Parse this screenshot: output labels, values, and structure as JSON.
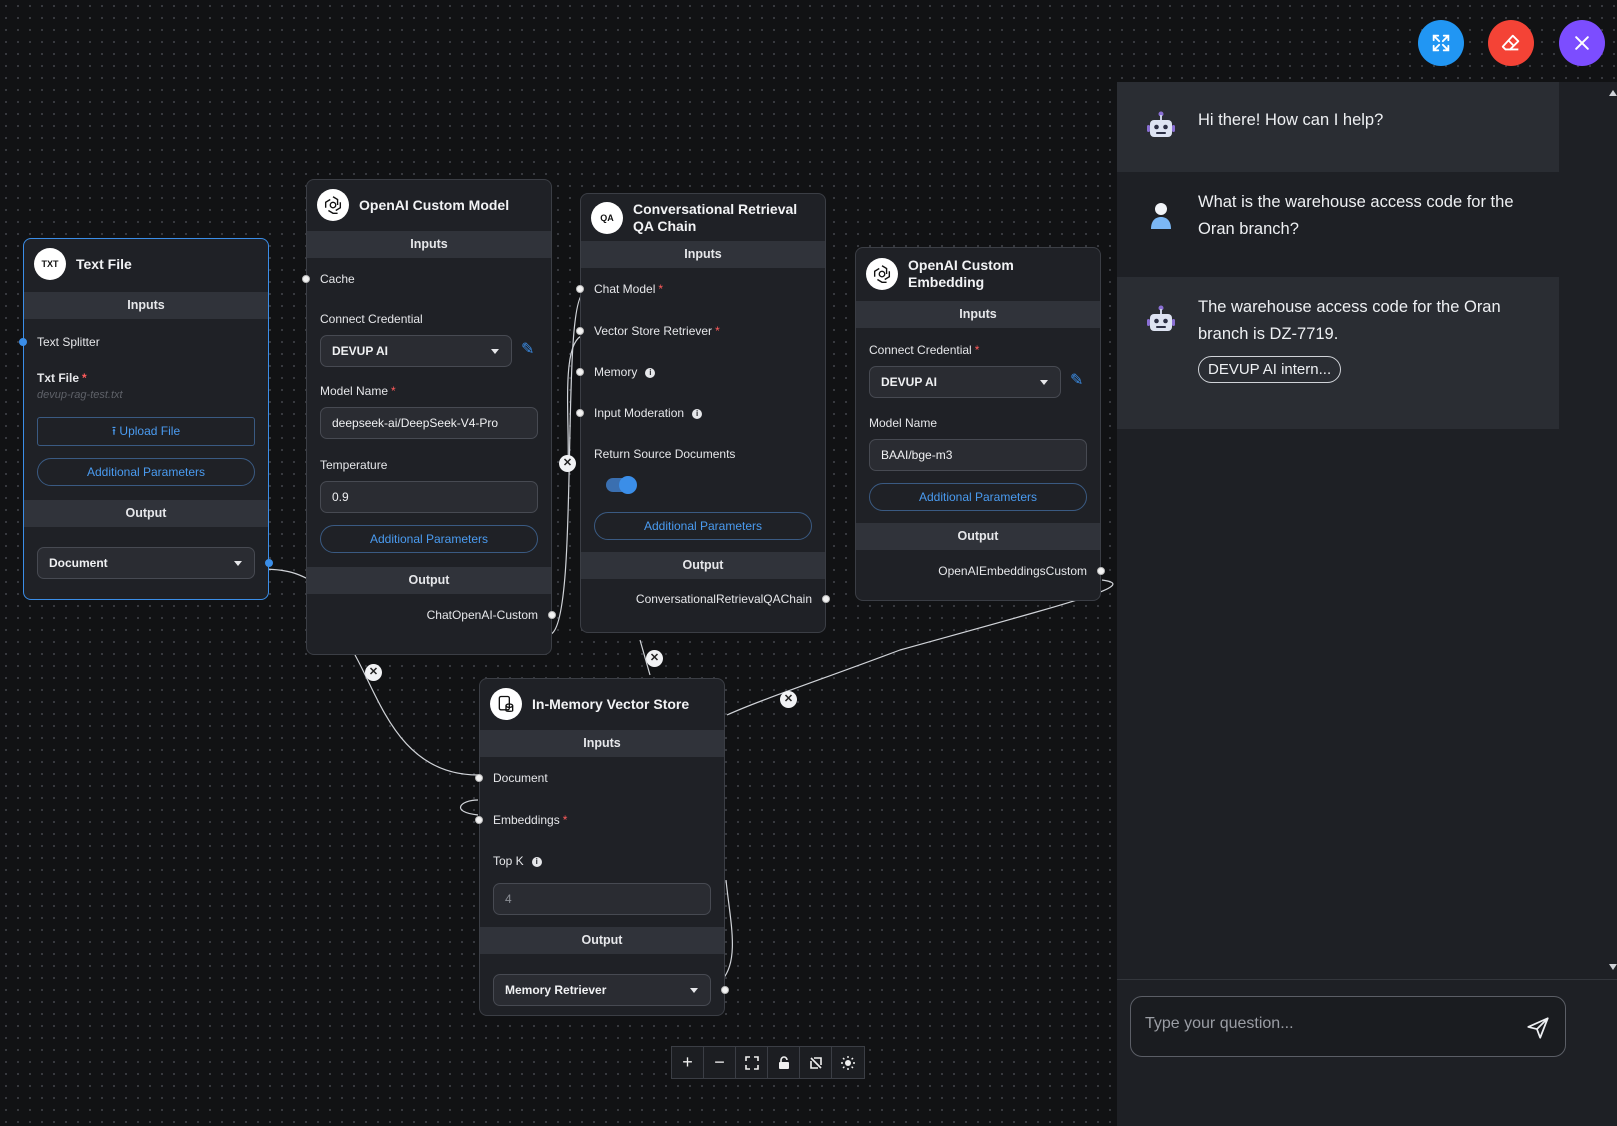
{
  "nodes": {
    "text_file": {
      "title": "Text File",
      "icon_text": "TXT",
      "inputs_label": "Inputs",
      "text_splitter": "Text Splitter",
      "txt_file_label": "Txt File",
      "txt_file_value": "devup-rag-test.txt",
      "upload_label": "Upload File",
      "additional_params": "Additional Parameters",
      "output_label": "Output",
      "output_value": "Document"
    },
    "openai_model": {
      "title": "OpenAI Custom Model",
      "inputs_label": "Inputs",
      "cache": "Cache",
      "credential_label": "Connect Credential",
      "credential_value": "DEVUP AI",
      "model_name_label": "Model Name",
      "model_name_value": "deepseek-ai/DeepSeek-V4-Pro",
      "temperature_label": "Temperature",
      "temperature_value": "0.9",
      "additional_params": "Additional Parameters",
      "output_label": "Output",
      "output_value": "ChatOpenAI-Custom"
    },
    "qa_chain": {
      "title": "Conversational Retrieval QA Chain",
      "icon_text": "QA",
      "inputs_label": "Inputs",
      "chat_model": "Chat Model",
      "vector_retriever": "Vector Store Retriever",
      "memory": "Memory",
      "input_moderation": "Input Moderation",
      "return_source": "Return Source Documents",
      "return_source_enabled": true,
      "additional_params": "Additional Parameters",
      "output_label": "Output",
      "output_value": "ConversationalRetrievalQAChain"
    },
    "embedding": {
      "title": "OpenAI Custom Embedding",
      "inputs_label": "Inputs",
      "credential_label": "Connect Credential",
      "credential_value": "DEVUP AI",
      "model_name_label": "Model Name",
      "model_name_value": "BAAI/bge-m3",
      "additional_params": "Additional Parameters",
      "output_label": "Output",
      "output_value": "OpenAIEmbeddingsCustom"
    },
    "vector_store": {
      "title": "In-Memory Vector Store",
      "inputs_label": "Inputs",
      "document": "Document",
      "embeddings": "Embeddings",
      "top_k_label": "Top K",
      "top_k_placeholder": "4",
      "output_label": "Output",
      "output_value": "Memory Retriever"
    }
  },
  "chat": {
    "messages": [
      {
        "role": "bot",
        "text": "Hi there! How can I help?"
      },
      {
        "role": "user",
        "text": "What is the warehouse access code for the Oran branch?"
      },
      {
        "role": "bot",
        "text": "The warehouse access code for the Oran branch is DZ-7719.",
        "source": "DEVUP AI intern..."
      }
    ],
    "input_placeholder": "Type your question..."
  },
  "fab_colors": {
    "expand": "#2196f3",
    "clear": "#f44336",
    "close": "#7c4dff"
  },
  "icons": {
    "expand": "expand-icon",
    "clear": "eraser-icon",
    "close": "close-icon",
    "send": "send-icon",
    "robot": "robot-icon",
    "user": "user-icon",
    "zoom_in": "plus-icon",
    "zoom_out": "minus-icon",
    "fit": "fit-view-icon",
    "lock": "lock-icon",
    "snap": "snap-icon",
    "background": "background-icon"
  }
}
